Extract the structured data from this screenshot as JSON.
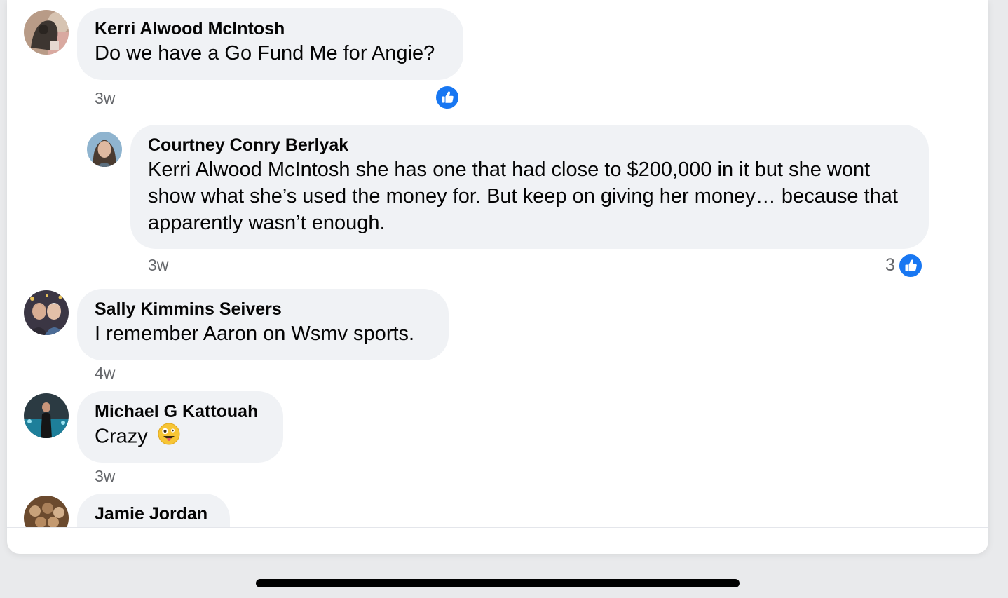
{
  "comments": [
    {
      "author": "Kerri Alwood McIntosh",
      "text": "Do we have a Go Fund Me for Angie?",
      "time": "3w",
      "reaction_icon": "thumbs-up-icon"
    },
    {
      "author": "Courtney Conry Berlyak",
      "text": "Kerri Alwood McIntosh she has one that had close to $200,000 in it but she wont show what she’s used the money for. But keep on giving her money… because that apparently wasn’t enough.",
      "time": "3w",
      "reaction_count": "3",
      "reaction_icon": "thumbs-up-icon"
    },
    {
      "author": "Sally Kimmins Seivers",
      "text": "I remember Aaron on Wsmv sports.",
      "time": "4w"
    },
    {
      "author": "Michael G Kattouah",
      "text": "Crazy",
      "emoji": "zany-face-icon",
      "time": "3w"
    },
    {
      "author": "Jamie Jordan"
    }
  ],
  "colors": {
    "like_blue": "#1877f2",
    "bubble_bg": "#f0f2f5",
    "meta_text": "#65676b"
  }
}
